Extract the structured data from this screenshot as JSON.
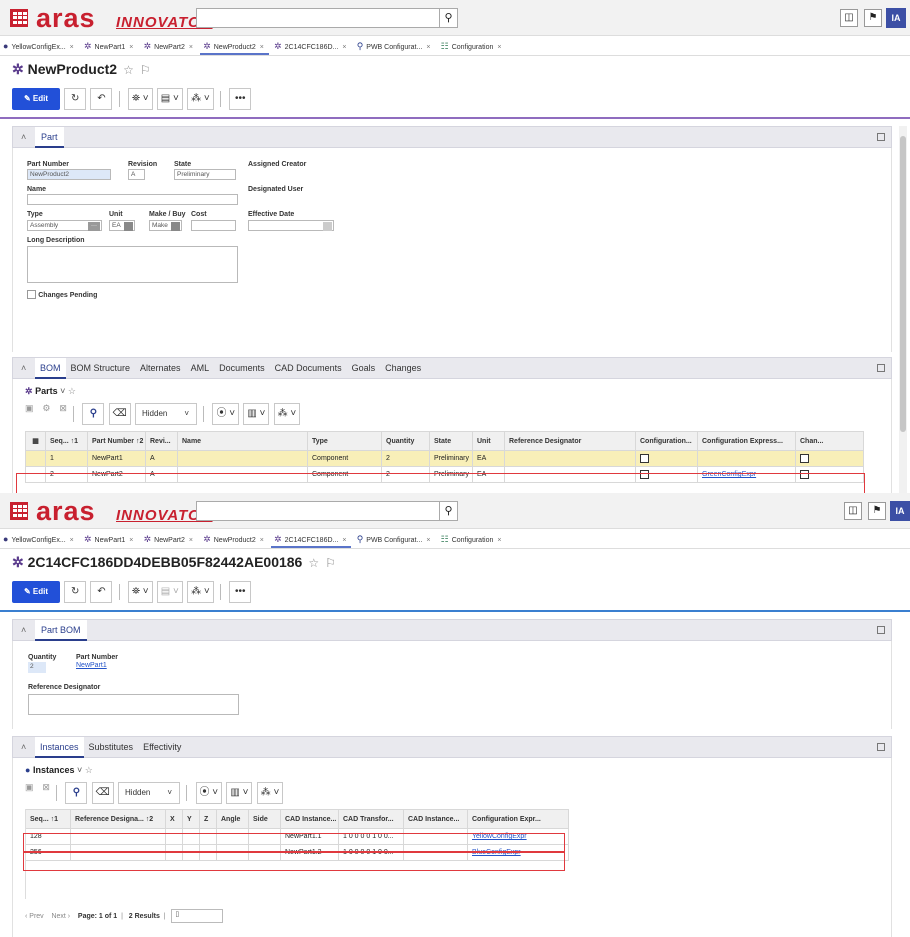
{
  "app": {
    "brand": "aras",
    "brand_sub": "INNOVATOR",
    "user_initials": "IA"
  },
  "tabs": [
    {
      "label": "YellowConfigEx...",
      "icon": "circle-icon"
    },
    {
      "label": "NewPart1",
      "icon": "part-icon"
    },
    {
      "label": "NewPart2",
      "icon": "part-icon"
    },
    {
      "label": "NewProduct2",
      "icon": "part-icon"
    },
    {
      "label": "2C14CFC186D...",
      "icon": "part-icon"
    },
    {
      "label": "PWB Configurat...",
      "icon": "search-icon"
    },
    {
      "label": "Configuration",
      "icon": "config-icon"
    }
  ],
  "top": {
    "title": "NewProduct2",
    "active_tab": 3,
    "toolbar": {
      "edit": "Edit"
    },
    "part_panel": {
      "tab": "Part",
      "fields": {
        "part_number_label": "Part Number",
        "part_number": "NewProduct2",
        "revision_label": "Revision",
        "revision": "A",
        "state_label": "State",
        "state": "Preliminary",
        "assigned_creator_label": "Assigned Creator",
        "name_label": "Name",
        "designated_user_label": "Designated User",
        "type_label": "Type",
        "type": "Assembly",
        "unit_label": "Unit",
        "unit": "EA",
        "make_buy_label": "Make / Buy",
        "make_buy": "Make",
        "cost_label": "Cost",
        "effective_date_label": "Effective Date",
        "long_desc_label": "Long Description",
        "changes_pending_label": "Changes Pending"
      }
    },
    "rel_tabs": [
      "BOM",
      "BOM Structure",
      "Alternates",
      "AML",
      "Documents",
      "CAD Documents",
      "Goals",
      "Changes"
    ],
    "grid_title": "Parts",
    "filter": "Hidden",
    "columns": [
      "Seq... ↑1",
      "Part Number ↑2",
      "Revi...",
      "Name",
      "Type",
      "Quantity",
      "State",
      "Unit",
      "Reference Designator",
      "Configuration...",
      "Configuration Express...",
      "Chan..."
    ],
    "rows": [
      {
        "seq": "1",
        "part": "NewPart1",
        "rev": "A",
        "name": "",
        "type": "Component",
        "qty": "2",
        "state": "Preliminary",
        "unit": "EA",
        "ref": "",
        "cfg_expr": ""
      },
      {
        "seq": "2",
        "part": "NewPart2",
        "rev": "A",
        "name": "",
        "type": "Component",
        "qty": "2",
        "state": "Preliminary",
        "unit": "EA",
        "ref": "",
        "cfg_expr": "GreenConfigExpr"
      }
    ]
  },
  "bottom": {
    "title": "2C14CFC186DD4DEBB05F82442AE00186",
    "active_tab": 4,
    "toolbar": {
      "edit": "Edit"
    },
    "panel_tab": "Part BOM",
    "fields": {
      "quantity_label": "Quantity",
      "quantity": "2",
      "part_number_label": "Part Number",
      "part_number": "NewPart1",
      "ref_label": "Reference Designator"
    },
    "rel_tabs": [
      "Instances",
      "Substitutes",
      "Effectivity"
    ],
    "grid_title": "Instances",
    "filter": "Hidden",
    "columns": [
      "Seq... ↑1",
      "Reference Designa... ↑2",
      "X",
      "Y",
      "Z",
      "Angle",
      "Side",
      "CAD Instance...",
      "CAD Transfor...",
      "CAD Instance...",
      "Configuration Expr..."
    ],
    "rows": [
      {
        "seq": "128",
        "cad_inst": "NewPart1.1",
        "cad_trans": "1 0 0 0 0 1 0 0...",
        "cfg": "YellowConfigExpr"
      },
      {
        "seq": "256",
        "cad_inst": "NewPart1.2",
        "cad_trans": "1 0 0 0 0 1 0 0...",
        "cfg": "BlueConfigExpr"
      }
    ],
    "pager": {
      "prev": "‹ Prev",
      "next": "Next ›",
      "page": "Page: 1 of 1",
      "results": "2 Results"
    }
  }
}
